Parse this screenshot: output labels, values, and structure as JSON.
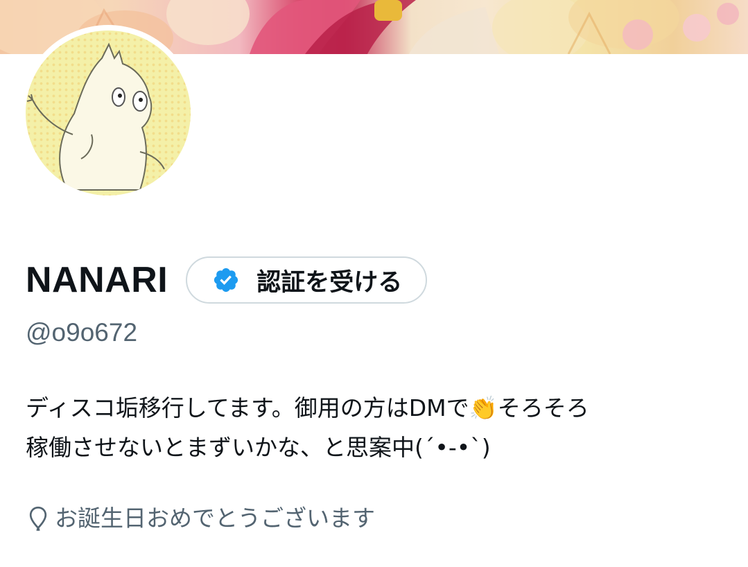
{
  "profile": {
    "display_name": "NANARI",
    "handle": "@o9o672",
    "verify_button_label": "認証を受ける",
    "bio_line_1": "ディスコ垢移行してます。御用の方はDMで👏そろそろ",
    "bio_line_2": "稼働させないとまずいかな、と思案中(´•-•`)",
    "location": "お誕生日おめでとうございます"
  },
  "icons": {
    "verified_badge": "verified-badge-icon",
    "location": "location-pin-icon"
  },
  "colors": {
    "text_primary": "#0f1419",
    "text_secondary": "#536471",
    "verified_blue": "#1d9bf0",
    "button_border": "#cfd9de"
  }
}
